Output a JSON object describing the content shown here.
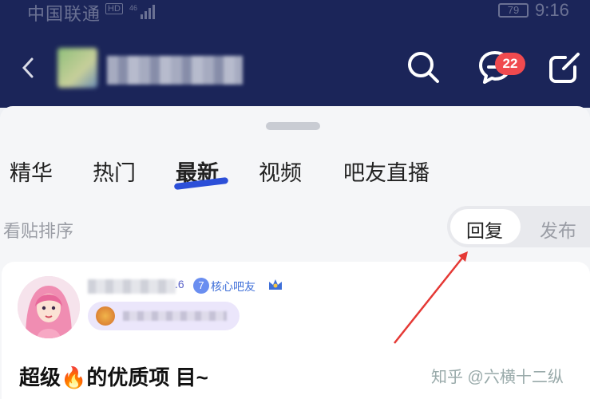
{
  "status_bar": {
    "carrier": "中国联通",
    "hd": "HD",
    "signal": "46",
    "battery": "79",
    "time": "9:16"
  },
  "header": {
    "message_badge": "22",
    "icons": [
      "back-icon",
      "search-icon",
      "message-icon",
      "edit-icon"
    ]
  },
  "tabs": [
    {
      "label": "精华"
    },
    {
      "label": "热门"
    },
    {
      "label": "最新",
      "active": true
    },
    {
      "label": "视频"
    },
    {
      "label": "吧友直播"
    }
  ],
  "sort": {
    "label": "看贴排序",
    "options": [
      "回复",
      "发布"
    ],
    "selected": "回复"
  },
  "post": {
    "username_suffix": ".6",
    "level": "7",
    "tag": "核心吧友",
    "title": "超级🔥的优质项 目~"
  },
  "watermark": "知乎 @六横十二纵",
  "colors": {
    "header_bg": "#1b2559",
    "badge_red": "#f04a4f",
    "accent_blue": "#2c4fd8",
    "annotation_red": "#e53935"
  }
}
